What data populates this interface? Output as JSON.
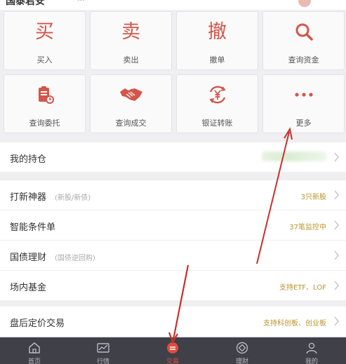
{
  "header": {
    "title": "国泰君安",
    "subtitle": "···"
  },
  "quick_actions": [
    {
      "label": "买入",
      "glyph": "买",
      "icon": "buy-glyph-icon"
    },
    {
      "label": "卖出",
      "glyph": "卖",
      "icon": "sell-glyph-icon"
    },
    {
      "label": "撤单",
      "glyph": "撤",
      "icon": "cancel-order-glyph-icon"
    },
    {
      "label": "查询资金",
      "icon": "search-icon"
    },
    {
      "label": "查询委托",
      "icon": "clipboard-icon"
    },
    {
      "label": "查询成交",
      "icon": "handshake-icon"
    },
    {
      "label": "银证转账",
      "icon": "yuan-transfer-icon"
    },
    {
      "label": "更多",
      "icon": "more-dots-icon"
    }
  ],
  "holdings": {
    "label": "我的持仓"
  },
  "services": [
    {
      "label": "打新神器",
      "tag": "(新股/新债)",
      "value": "3只新股"
    },
    {
      "label": "智能条件单",
      "tag": "",
      "value": "37笔监控中"
    },
    {
      "label": "国债理财",
      "tag": "(国债逆回购)",
      "value": ""
    },
    {
      "label": "场内基金",
      "tag": "",
      "value": "支持ETF、LOF"
    }
  ],
  "after_hours": {
    "label": "盘后定价交易",
    "value": "支持科创板、创业板"
  },
  "tabbar": {
    "items": [
      {
        "label": "首页",
        "icon": "home-icon"
      },
      {
        "label": "行情",
        "icon": "chart-icon"
      },
      {
        "label": "交易",
        "icon": "trade-icon"
      },
      {
        "label": "理财",
        "icon": "wealth-icon"
      },
      {
        "label": "我的",
        "icon": "profile-icon"
      }
    ]
  },
  "colors": {
    "accent": "#d4554a",
    "value_gold": "#b8942f",
    "tabbar_bg": "#3f4048",
    "annotation_red": "#c9302c"
  }
}
